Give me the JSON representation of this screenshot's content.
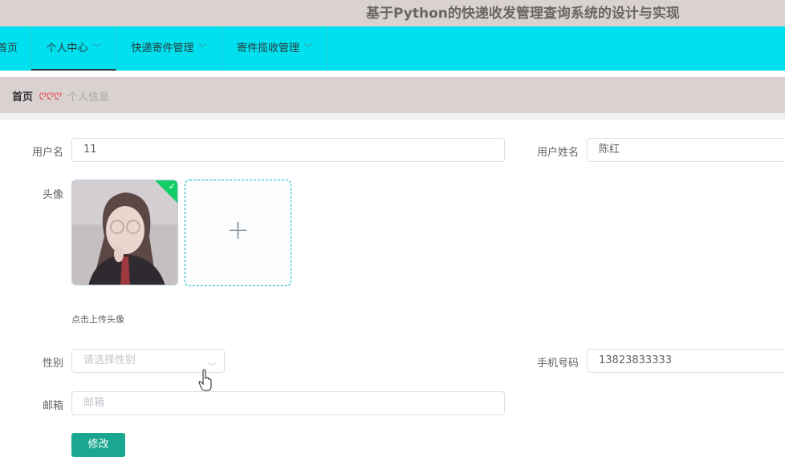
{
  "app": {
    "title": "基于Python的快递收发管理查询系统的设计与实现"
  },
  "nav": {
    "items": [
      {
        "label": "首页"
      },
      {
        "label": "个人中心"
      },
      {
        "label": "快递寄件管理"
      },
      {
        "label": "寄件揽收管理"
      }
    ]
  },
  "breadcrumb": {
    "home": "首页",
    "separator": "ღღღ",
    "current": "个人信息"
  },
  "form": {
    "username": {
      "label": "用户名",
      "value": "11"
    },
    "realname": {
      "label": "用户姓名",
      "value": "陈红"
    },
    "avatar": {
      "label": "头像",
      "hint": "点击上传头像",
      "upload_icon": "plus-icon"
    },
    "gender": {
      "label": "性别",
      "placeholder": "请选择性别"
    },
    "phone": {
      "label": "手机号码",
      "value": "13823833333"
    },
    "email": {
      "label": "邮箱",
      "placeholder": "邮箱"
    },
    "submit_label": "修改"
  },
  "colors": {
    "nav_bg": "#00e0ee",
    "header_bg": "#d9d2d0",
    "button": "#1aa78f",
    "upload_border": "#00b5c5"
  }
}
